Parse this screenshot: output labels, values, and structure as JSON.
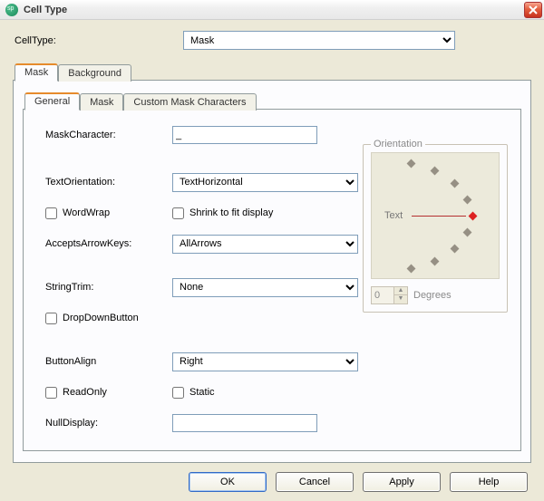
{
  "window": {
    "title": "Cell Type"
  },
  "header": {
    "label": "CellType:",
    "value": "Mask"
  },
  "outer_tabs": {
    "items": [
      {
        "label": "Mask"
      },
      {
        "label": "Background"
      }
    ]
  },
  "inner_tabs": {
    "items": [
      {
        "label": "General"
      },
      {
        "label": "Mask"
      },
      {
        "label": "Custom Mask Characters"
      }
    ]
  },
  "general": {
    "mask_char_label": "MaskCharacter:",
    "mask_char_value": "_",
    "text_orientation_label": "TextOrientation:",
    "text_orientation_value": "TextHorizontal",
    "wordwrap_label": "WordWrap",
    "shrink_label": "Shrink to fit display",
    "accepts_arrow_label": "AcceptsArrowKeys:",
    "accepts_arrow_value": "AllArrows",
    "string_trim_label": "StringTrim:",
    "string_trim_value": "None",
    "dropdown_button_label": "DropDownButton",
    "button_align_label": "ButtonAlign",
    "button_align_value": "Right",
    "readonly_label": "ReadOnly",
    "static_label": "Static",
    "null_display_label": "NullDisplay:",
    "null_display_value": ""
  },
  "orientation": {
    "legend": "Orientation",
    "text": "Text",
    "degrees_value": "0",
    "degrees_label": "Degrees"
  },
  "buttons": {
    "ok": "OK",
    "cancel": "Cancel",
    "apply": "Apply",
    "help": "Help"
  }
}
